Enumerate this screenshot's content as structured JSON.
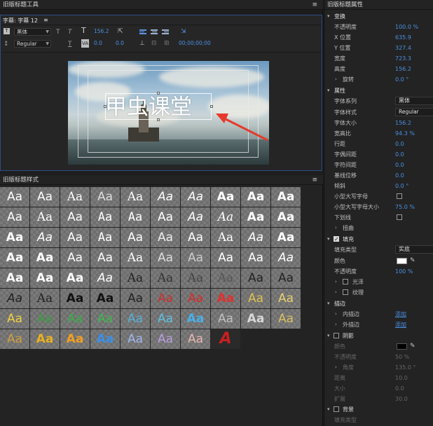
{
  "title_tool": {
    "panel_title": "旧版标题工具",
    "tab_label": "字幕: 字幕 12",
    "tab_menu": "≡",
    "font_family": "黑体",
    "font_style": "Regular",
    "font_size": "156.2",
    "kerning": "0.0",
    "leading": "0.0",
    "timecode": "00;00;00;00",
    "title_text": "甲虫课堂"
  },
  "styles_panel": {
    "panel_title": "旧版标题样式",
    "swatch_text": "Aa"
  },
  "properties": {
    "panel_title": "旧版标题属性",
    "transform": {
      "section": "变换",
      "opacity_label": "不透明度",
      "opacity": "100.0 %",
      "x_label": "X 位置",
      "x": "635.9",
      "y_label": "Y 位置",
      "y": "327.4",
      "width_label": "宽度",
      "width": "723.3",
      "height_label": "高度",
      "height": "156.2",
      "rotation_label": "旋转",
      "rotation": "0.0 °"
    },
    "attributes": {
      "section": "属性",
      "font_family_label": "字体系列",
      "font_family": "黑体",
      "font_style_label": "字体样式",
      "font_style": "Regular",
      "font_size_label": "字体大小",
      "font_size": "156.2",
      "aspect_label": "宽高比",
      "aspect": "94.3 %",
      "leading_label": "行距",
      "leading": "0.0",
      "kerning_label": "字偶间距",
      "kerning": "0.0",
      "tracking_label": "字符间距",
      "tracking": "0.0",
      "baseline_label": "基线位移",
      "baseline": "0.0",
      "slant_label": "倾斜",
      "slant": "0.0 °",
      "smallcaps_label": "小型大写字母",
      "smallcaps_size_label": "小型大写字母大小",
      "smallcaps_size": "75.0 %",
      "underline_label": "下划线",
      "distort_label": "扭曲"
    },
    "fill": {
      "section": "填充",
      "fill_type_label": "填充类型",
      "fill_type": "实底",
      "color_label": "颜色",
      "color": "#ffffff",
      "opacity_label": "不透明度",
      "opacity": "100 %",
      "sheen_label": "光泽",
      "texture_label": "纹理"
    },
    "stroke": {
      "section": "描边",
      "inner_label": "内描边",
      "inner_action": "添加",
      "outer_label": "外描边",
      "outer_action": "添加"
    },
    "shadow": {
      "section": "阴影",
      "color_label": "颜色",
      "color": "#000000",
      "opacity_label": "不透明度",
      "opacity": "50 %",
      "angle_label": "角度",
      "angle": "135.0 °",
      "distance_label": "距离",
      "distance": "10.0",
      "size_label": "大小",
      "size": "0.0",
      "spread_label": "扩展",
      "spread": "30.0"
    },
    "background": {
      "section": "背景",
      "fill_type_label": "填充类型"
    }
  },
  "menu_glyph": "≡"
}
